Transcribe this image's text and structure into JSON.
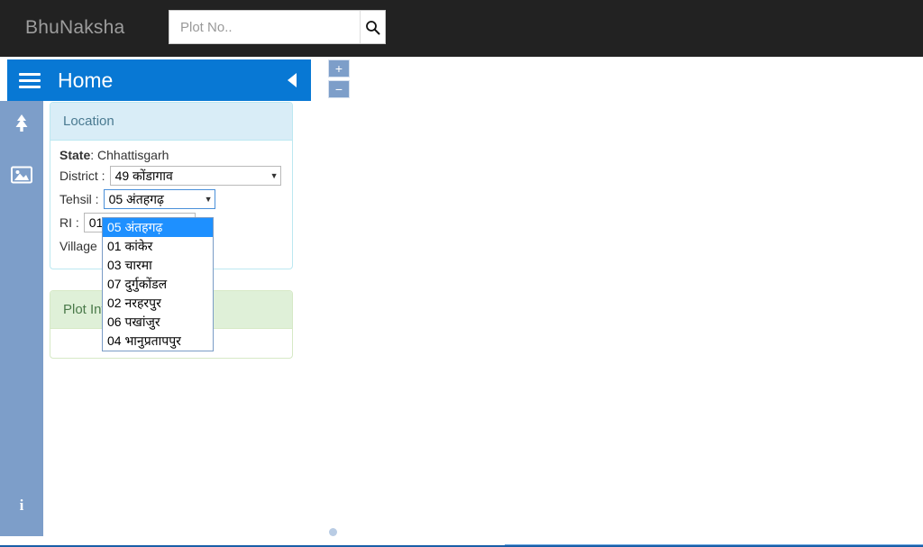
{
  "topbar": {
    "brand": "BhuNaksha",
    "search": {
      "placeholder": "Plot No..",
      "value": "",
      "button_icon": "search-icon"
    }
  },
  "panel_header": {
    "menu_icon": "hamburger-icon",
    "title": "Home",
    "collapse_icon": "caret-left-icon"
  },
  "zoom_control": {
    "zoom_in_label": "+",
    "zoom_out_label": "−"
  },
  "rail": {
    "items": [
      {
        "icon": "tree-icon",
        "name": "layers-tree"
      },
      {
        "icon": "image-icon",
        "name": "imagery"
      }
    ],
    "info": {
      "icon": "info-icon",
      "label": "i"
    }
  },
  "location_card": {
    "title": "Location",
    "state": {
      "label": "State",
      "separator": ": ",
      "value": "Chhattisgarh"
    },
    "fields": [
      {
        "label": "District :",
        "value": "49 कोंडागाव",
        "caret": "▼"
      },
      {
        "label": "Tehsil :",
        "value": "05 अंतहगढ़",
        "caret": "▼"
      },
      {
        "label": "RI :",
        "value": "01",
        "caret": "▼"
      },
      {
        "label": "Village",
        "value": "",
        "caret": "▼"
      }
    ]
  },
  "tehsil_dropdown": {
    "open": true,
    "options": [
      "05 अंतहगढ़",
      "01 कांकेर",
      "03 चारमा",
      "07 दुर्गुकोंडल",
      "02 नरहरपुर",
      "06 पखांजुर",
      "04 भानुप्रतापपुर"
    ],
    "selected_index": 0
  },
  "plot_card": {
    "title": "Plot Info"
  },
  "colors": {
    "topbar_bg": "#222222",
    "accent_blue": "#0878d4",
    "rail_blue": "#7d9ec9",
    "location_head": "#d9edf7",
    "plot_head": "#dff0d8",
    "dropdown_highlight": "#1e90ff"
  }
}
